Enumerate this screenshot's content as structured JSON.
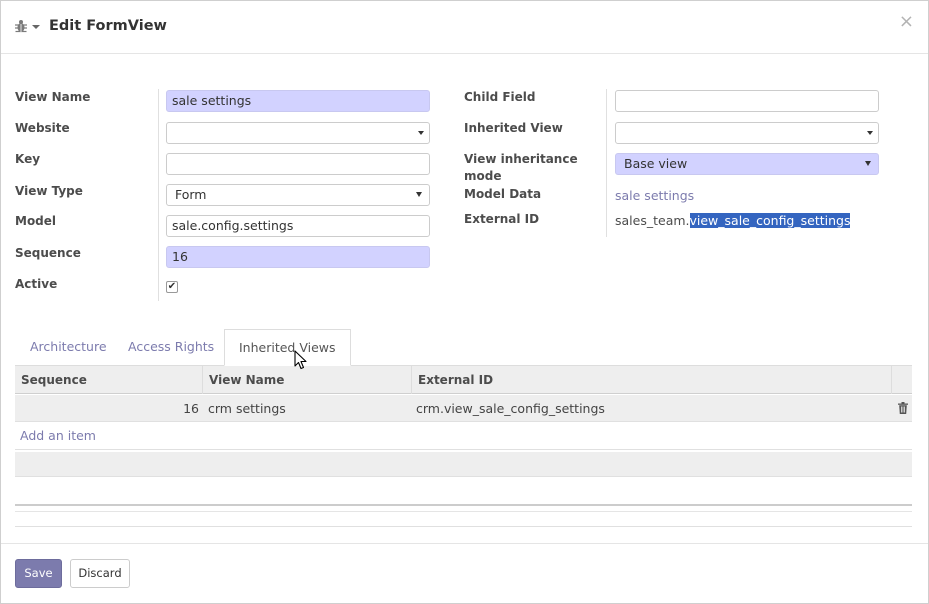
{
  "dialog": {
    "title": "Edit FormView",
    "close": "×"
  },
  "form": {
    "left": {
      "view_name_label": "View Name",
      "view_name_value": "sale settings",
      "website_label": "Website",
      "website_value": "",
      "key_label": "Key",
      "key_value": "",
      "view_type_label": "View Type",
      "view_type_value": "Form",
      "model_label": "Model",
      "model_value": "sale.config.settings",
      "sequence_label": "Sequence",
      "sequence_value": "16",
      "active_label": "Active",
      "active_checked": true
    },
    "right": {
      "child_field_label": "Child Field",
      "child_field_value": "",
      "inherited_view_label": "Inherited View",
      "inherited_view_value": "",
      "inheritance_mode_label_1": "View inheritance",
      "inheritance_mode_label_2": "mode",
      "inheritance_mode_value": "Base view",
      "model_data_label": "Model Data",
      "model_data_value": "sale settings",
      "external_id_label": "External ID",
      "external_id_prefix": "sales_team.",
      "external_id_selected": "view_sale_config_settings"
    }
  },
  "tabs": [
    {
      "label": "Architecture",
      "active": false
    },
    {
      "label": "Access Rights",
      "active": false
    },
    {
      "label": "Inherited Views",
      "active": true
    }
  ],
  "table": {
    "columns": [
      "Sequence",
      "View Name",
      "External ID"
    ],
    "rows": [
      {
        "sequence": "16",
        "view_name": "crm settings",
        "external_id": "crm.view_sale_config_settings"
      }
    ],
    "add_item": "Add an item"
  },
  "footer": {
    "save": "Save",
    "discard": "Discard"
  },
  "colors": {
    "brand": "#7c7bad",
    "required_field": "#d2d2ff",
    "selection": "#3465c0"
  }
}
